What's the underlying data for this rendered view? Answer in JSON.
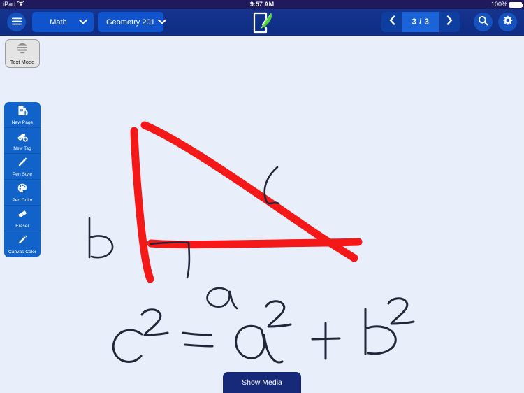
{
  "status_bar": {
    "device": "iPad",
    "wifi_icon": "wifi-icon",
    "time": "9:57 AM",
    "battery_percent": "100%",
    "battery_icon": "battery-full-icon"
  },
  "toolbar": {
    "menu_icon": "hamburger-menu-icon",
    "subject_dropdown": {
      "value": "Math",
      "chevron_icon": "chevron-down-icon"
    },
    "course_dropdown": {
      "value": "Geometry 201",
      "chevron_icon": "chevron-down-icon"
    },
    "logo_icon": "notepad-quill-logo-icon",
    "pager": {
      "prev_icon": "chevron-left-icon",
      "count": "3 / 3",
      "next_icon": "chevron-right-icon"
    },
    "search_icon": "search-icon",
    "settings_icon": "gear-icon"
  },
  "text_mode": {
    "label": "Text Mode",
    "icon": "text-lines-circle-icon"
  },
  "palette": {
    "items": [
      {
        "label": "New Page",
        "icon": "page-plus-icon"
      },
      {
        "label": "New Tag",
        "icon": "tag-plus-icon"
      },
      {
        "label": "Pen Style",
        "icon": "pen-icon"
      },
      {
        "label": "Pen Color",
        "icon": "color-palette-icon"
      },
      {
        "label": "Eraser",
        "icon": "eraser-icon"
      },
      {
        "label": "Canvas Color",
        "icon": "brush-icon"
      }
    ]
  },
  "canvas": {
    "background_color": "#e8eefa",
    "ink_red": "#f51818",
    "ink_dark": "#222639",
    "annotations": {
      "side_b_label": "b",
      "side_a_label": "a",
      "equation": "c² = a² + b²",
      "right_angle_marker": "right-angle-square",
      "angle_arc_marker": "angle-arc"
    }
  },
  "show_media": {
    "label": "Show Media"
  },
  "colors": {
    "statusbar_bg": "#201a5c",
    "toolbar_bg": "#113088",
    "accent_blue": "#1263c9",
    "pager_center": "#1a63d8",
    "showmedia_bg": "#172a7a"
  }
}
